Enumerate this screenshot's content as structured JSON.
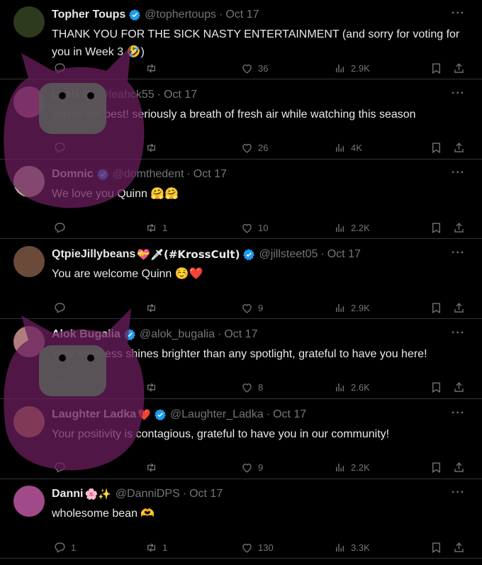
{
  "tweets": [
    {
      "name": "Topher Toups",
      "name_extra": "",
      "handle": "@tophertoups",
      "date": "Oct 17",
      "text": "THANK YOU FOR THE SICK NASTY ENTERTAINMENT (and sorry for voting for you in Week 3 🤣)",
      "replies": "",
      "retweets": "",
      "likes": "36",
      "views": "2.9K",
      "avatar_color": "#2d3a1e",
      "verified": true,
      "name_color": "#e7e9ea"
    },
    {
      "name": "Leah",
      "name_extra": "",
      "handle": "@leahck55",
      "date": "Oct 17",
      "text": "you're the best! seriously a breath of fresh air while watching this season",
      "replies": "",
      "retweets": "",
      "likes": "26",
      "views": "4K",
      "avatar_color": "#b06c8c",
      "verified": true,
      "name_color": "#e7e9ea"
    },
    {
      "name": "Domnic",
      "name_extra": "",
      "handle": "@domthedent",
      "date": "Oct 17",
      "text": "We love you Quinn 🤗🤗",
      "replies": "",
      "retweets": "1",
      "likes": "10",
      "views": "2.2K",
      "avatar_color": "#c9bfa8",
      "verified": true,
      "name_color": "#e7e9ea"
    },
    {
      "name": "QtpieJillybeans",
      "name_extra": "💝🗡(#KrossCult)",
      "handle": "@jillsteet05",
      "date": "Oct 17",
      "text": "You are welcome Quinn ☺️❤️",
      "replies": "",
      "retweets": "",
      "likes": "9",
      "views": "2.9K",
      "avatar_color": "#6b4a3a",
      "verified": true,
      "name_color": "#e7e9ea"
    },
    {
      "name": "Alok Bugalia",
      "name_extra": "",
      "handle": "@alok_bugalia",
      "date": "Oct 17",
      "text": "Your kindness shines brighter than any spotlight, grateful to have you here!",
      "replies": "",
      "retweets": "",
      "likes": "8",
      "views": "2.6K",
      "avatar_color": "#b07d7d",
      "verified": true,
      "name_color": "#e7e9ea"
    },
    {
      "name": "Laughter Ladka",
      "name_extra": "❤️",
      "handle": "@Laughter_Ladka",
      "date": "Oct 17",
      "text": "Your positivity is contagious, grateful to have you in our community!",
      "replies": "",
      "retweets": "",
      "likes": "9",
      "views": "2.2K",
      "avatar_color": "#c08a4a",
      "verified": true,
      "name_color": "#e7e9ea"
    },
    {
      "name": "Danni",
      "name_extra": "🌸✨",
      "handle": "@DanniDPS",
      "date": "Oct 17",
      "text": "wholesome bean 🫶",
      "replies": "1",
      "retweets": "1",
      "likes": "130",
      "views": "3.3K",
      "avatar_color": "#a04a8a",
      "verified": false,
      "name_color": "#e7e9ea"
    }
  ],
  "colors": {
    "background": "#000000",
    "text": "#e7e9ea",
    "muted": "#71767b",
    "verified": "#1d9bf0",
    "watermark": "#6b1f5e"
  },
  "icons": {
    "reply": "reply-icon",
    "retweet": "retweet-icon",
    "like": "heart-icon",
    "views": "views-icon",
    "bookmark": "bookmark-icon",
    "share": "share-icon",
    "more": "more-icon",
    "verified": "verified-badge-icon"
  }
}
